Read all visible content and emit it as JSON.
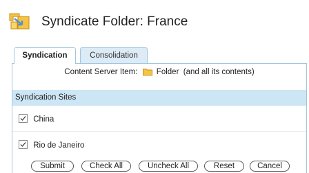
{
  "header": {
    "title": "Syndicate Folder: France",
    "icon": "syndicate-folder-icon"
  },
  "tabs": [
    {
      "label": "Syndication",
      "active": true
    },
    {
      "label": "Consolidation",
      "active": false
    }
  ],
  "content_item": {
    "label": "Content Server Item:",
    "icon": "folder-icon",
    "value": "Folder  (and all its contents)"
  },
  "sites": {
    "header": "Syndication Sites",
    "items": [
      {
        "label": "China",
        "checked": true
      },
      {
        "label": "Rio de Janeiro",
        "checked": true
      }
    ]
  },
  "buttons": {
    "submit": "Submit",
    "check_all": "Check All",
    "uncheck_all": "Uncheck All",
    "reset": "Reset",
    "cancel": "Cancel"
  },
  "colors": {
    "tab_border": "#9fc7dd",
    "tab_inactive_bg": "#dcebf5",
    "section_header_bg": "#cde6f6",
    "folder_yellow": "#f4c542",
    "icon_orange": "#f0a030",
    "icon_blue": "#5a8fd0"
  }
}
